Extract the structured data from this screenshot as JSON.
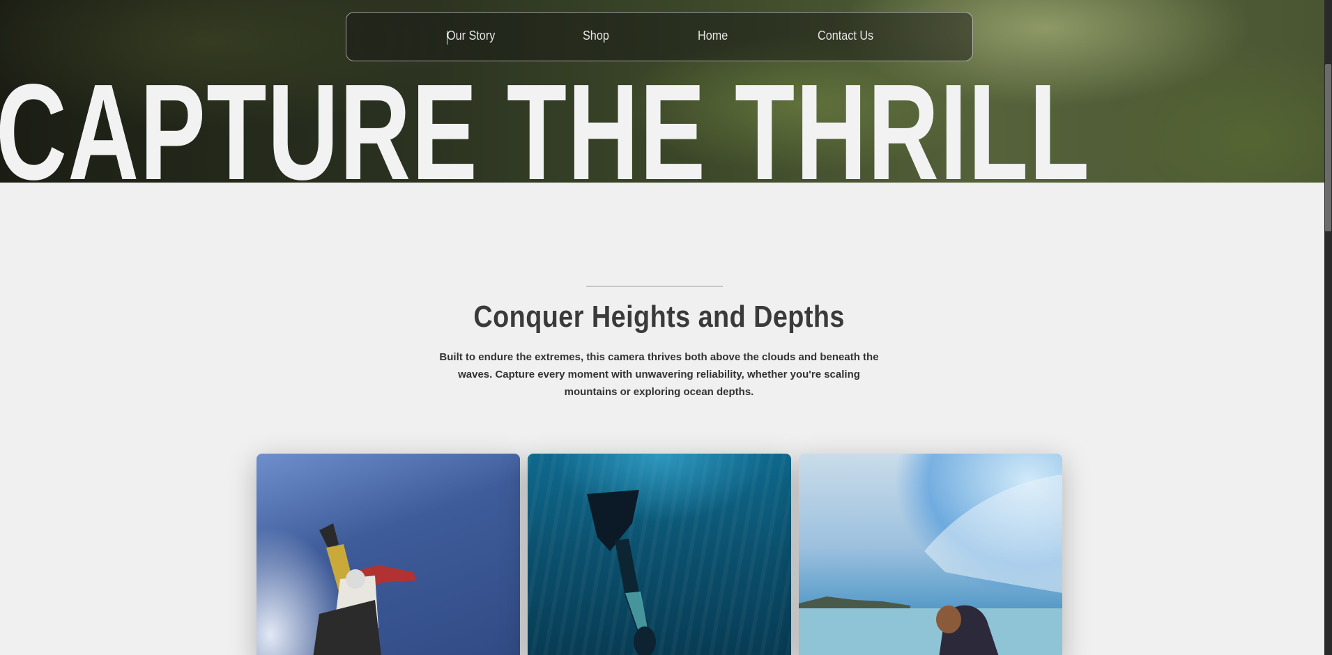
{
  "nav": {
    "items": [
      {
        "label": "Our Story"
      },
      {
        "label": "Shop"
      },
      {
        "label": "Home"
      },
      {
        "label": "Contact Us"
      }
    ]
  },
  "hero": {
    "headline": "CAPTURE THE THRILL"
  },
  "intro": {
    "title": "Conquer Heights and Depths",
    "body": "Built to endure the extremes, this camera thrives both above the clouds and beneath the waves. Capture every moment with unwavering reliability, whether you're scaling mountains or exploring ocean depths."
  },
  "cards": [
    {
      "subject": "skydiving"
    },
    {
      "subject": "freediving"
    },
    {
      "subject": "surfing"
    }
  ],
  "colors": {
    "page_bg": "#f0f0f0",
    "headline": "#f2f2f2",
    "title": "#3a3a3a",
    "body": "#333333"
  }
}
